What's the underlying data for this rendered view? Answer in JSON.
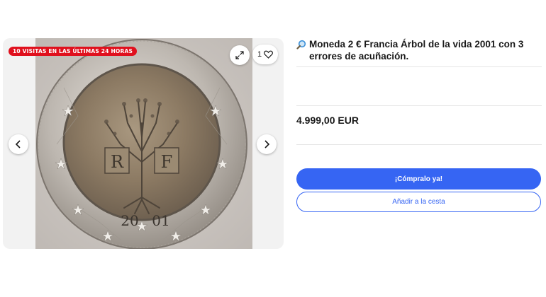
{
  "gallery": {
    "badge": "10 VISITAS EN LAS ÚLTIMAS 24 HORAS",
    "watch_count": "1",
    "expand_icon": "expand-icon",
    "heart_icon": "heart-icon",
    "prev_icon": "chevron-left-icon",
    "next_icon": "chevron-right-icon",
    "coin_year_left": "20",
    "coin_year_right": "01",
    "coin_letter_left": "R",
    "coin_letter_right": "F"
  },
  "listing": {
    "title_icon": "magnifier-icon",
    "title": "Moneda 2 € Francia Árbol de la vida 2001 con 3 errores de acuñación.",
    "price": "4.999,00 EUR",
    "buy_now_label": "¡Cómpralo ya!",
    "add_to_cart_label": "Añadir a la cesta"
  },
  "colors": {
    "badge_red": "#e0101d",
    "primary_blue": "#3665f3"
  }
}
